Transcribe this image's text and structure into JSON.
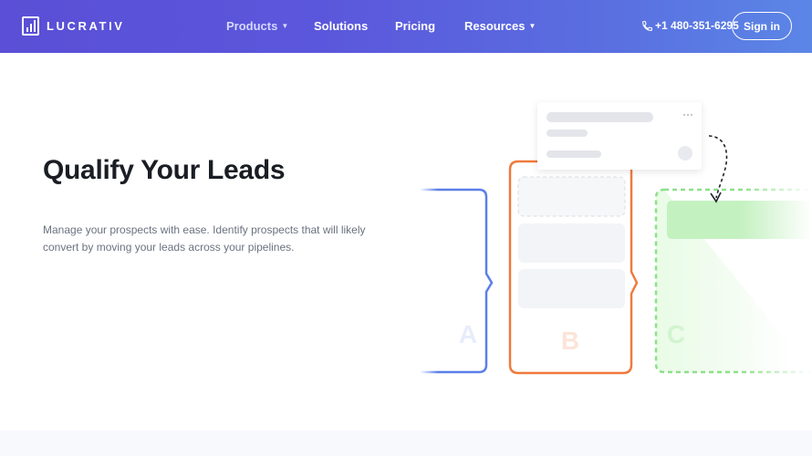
{
  "nav": {
    "brand": "LUCRATIV",
    "items": [
      {
        "label": "Products",
        "caret": true
      },
      {
        "label": "Solutions",
        "caret": false
      },
      {
        "label": "Pricing",
        "caret": false
      },
      {
        "label": "Resources",
        "caret": true
      }
    ],
    "phone": "+1 480-351-6295",
    "signin_label": "Sign in"
  },
  "hero": {
    "title": "Qualify Your Leads",
    "description": "Manage your prospects with ease. Identify prospects that will likely convert by moving your leads across your pipelines."
  },
  "pipeline": {
    "columns": [
      {
        "label": "A",
        "color": "#5b7fe8"
      },
      {
        "label": "B",
        "color": "#ef7a3d"
      },
      {
        "label": "C",
        "color": "#8de08a"
      }
    ]
  },
  "colors": {
    "nav_start": "#5a4fd6",
    "nav_end": "#5b86e6",
    "title": "#1a1d24",
    "body_text": "#6b7280"
  }
}
